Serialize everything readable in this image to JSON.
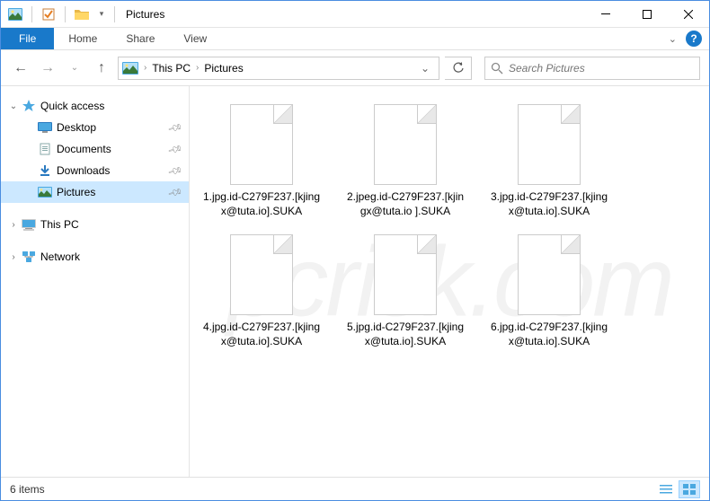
{
  "window": {
    "title": "Pictures"
  },
  "ribbon": {
    "file": "File",
    "tabs": [
      "Home",
      "Share",
      "View"
    ]
  },
  "breadcrumb": {
    "root": "This PC",
    "current": "Pictures"
  },
  "search": {
    "placeholder": "Search Pictures"
  },
  "sidebar": {
    "quick_access": "Quick access",
    "items": [
      {
        "label": "Desktop",
        "pinned": true
      },
      {
        "label": "Documents",
        "pinned": true
      },
      {
        "label": "Downloads",
        "pinned": true
      },
      {
        "label": "Pictures",
        "pinned": true,
        "selected": true
      }
    ],
    "this_pc": "This PC",
    "network": "Network"
  },
  "files": [
    {
      "name": "1.jpg.id-C279F237.[kjingx@tuta.io].SUKA"
    },
    {
      "name": "2.jpeg.id-C279F237.[kjingx@tuta.io ].SUKA"
    },
    {
      "name": "3.jpg.id-C279F237.[kjingx@tuta.io].SUKA"
    },
    {
      "name": "4.jpg.id-C279F237.[kjingx@tuta.io].SUKA"
    },
    {
      "name": "5.jpg.id-C279F237.[kjingx@tuta.io].SUKA"
    },
    {
      "name": "6.jpg.id-C279F237.[kjingx@tuta.io].SUKA"
    }
  ],
  "status": {
    "count": "6 items"
  },
  "watermark": "pcrisk.com"
}
